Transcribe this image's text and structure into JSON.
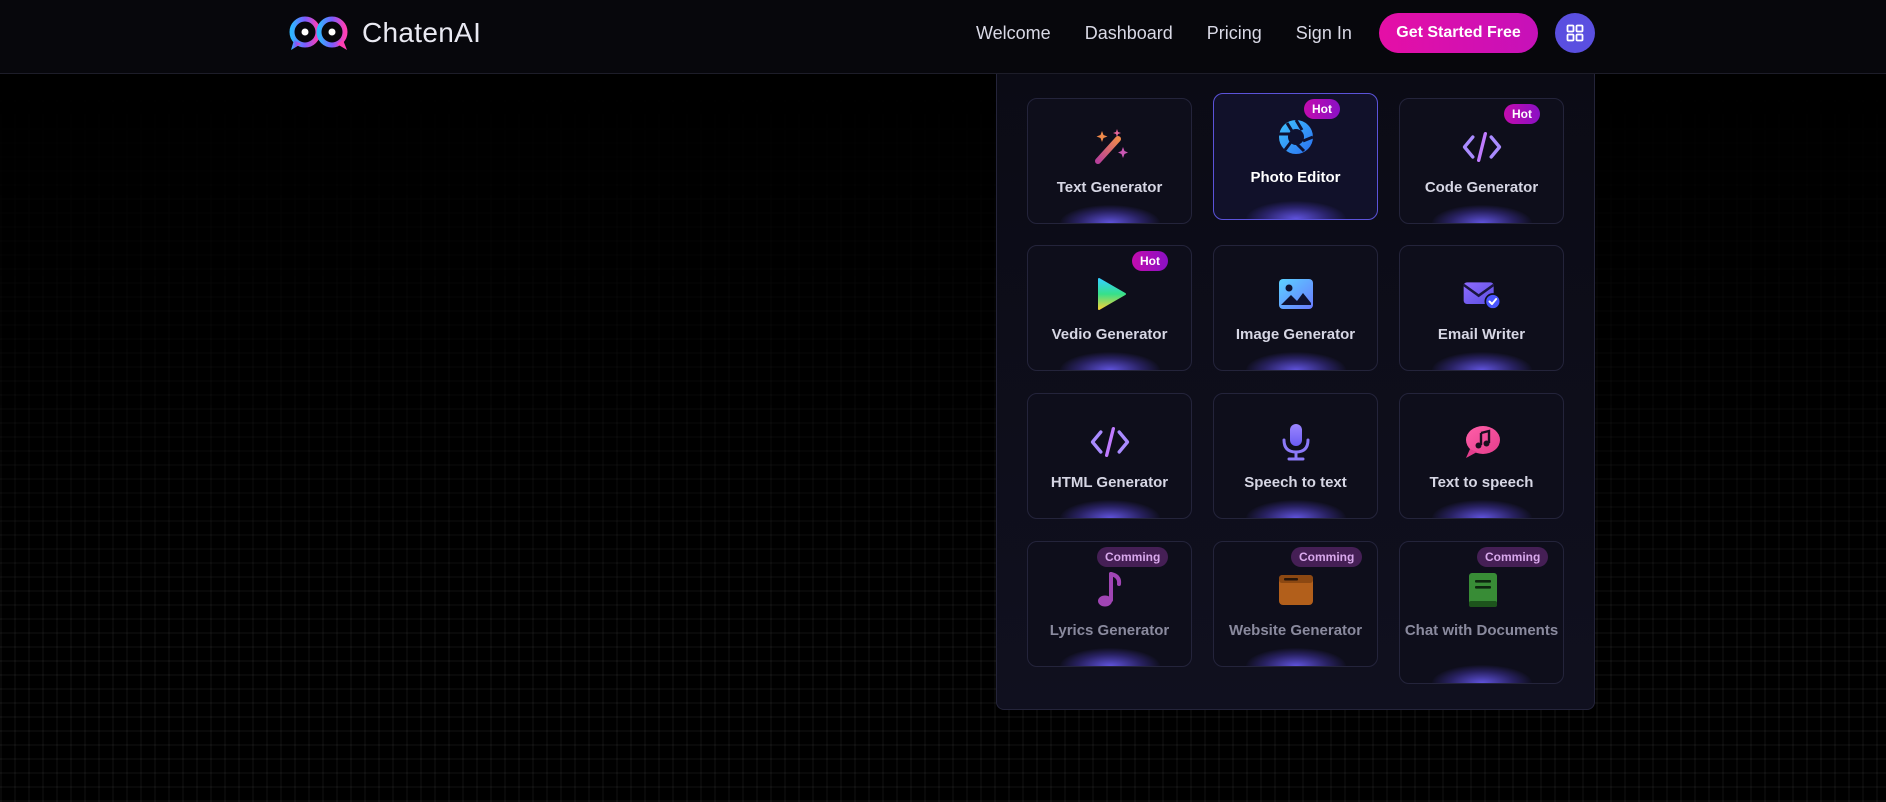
{
  "brand": {
    "name": "ChatenAI"
  },
  "nav": {
    "links": [
      "Welcome",
      "Dashboard",
      "Pricing",
      "Sign In"
    ],
    "cta_label": "Get Started Free",
    "apps_icon": "grid-icon"
  },
  "colors": {
    "accent_pink": "#e50fa6",
    "accent_purple": "#5a4fe0",
    "hot_badge": "#c30cae",
    "coming_badge": "#451f55"
  },
  "apps": [
    {
      "label": "Text Generator",
      "icon": "magic-wand-icon",
      "badge": ""
    },
    {
      "label": "Photo Editor",
      "icon": "camera-aperture-icon",
      "badge": "Hot"
    },
    {
      "label": "Code Generator",
      "icon": "code-icon",
      "badge": "Hot"
    },
    {
      "label": "Vedio Generator",
      "icon": "play-icon",
      "badge": "Hot"
    },
    {
      "label": "Image Generator",
      "icon": "image-icon",
      "badge": ""
    },
    {
      "label": "Email Writer",
      "icon": "email-check-icon",
      "badge": ""
    },
    {
      "label": "HTML Generator",
      "icon": "code-icon",
      "badge": ""
    },
    {
      "label": "Speech to text",
      "icon": "microphone-icon",
      "badge": ""
    },
    {
      "label": "Text to speech",
      "icon": "music-chat-icon",
      "badge": ""
    },
    {
      "label": "Lyrics Generator",
      "icon": "music-note-icon",
      "badge": "Comming"
    },
    {
      "label": "Website Generator",
      "icon": "browser-window-icon",
      "badge": "Comming"
    },
    {
      "label": "Chat with Documents",
      "icon": "book-icon",
      "badge": "Comming"
    }
  ]
}
